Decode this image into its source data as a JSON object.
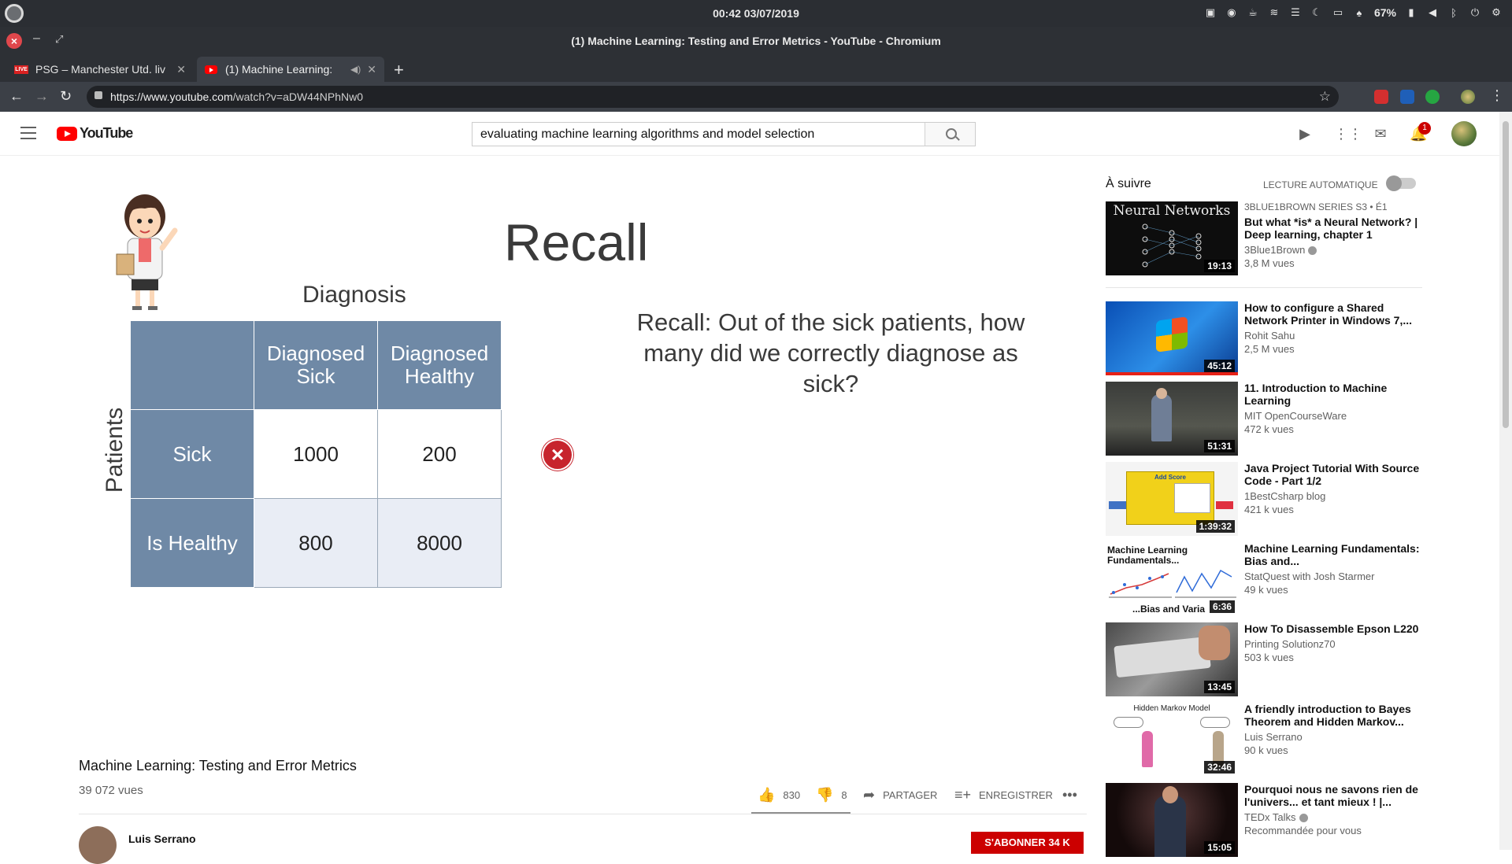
{
  "system": {
    "clock": "00:42 03/07/2019",
    "battery": "67%"
  },
  "window": {
    "title": "(1) Machine Learning: Testing and Error Metrics - YouTube - Chromium"
  },
  "tabs": [
    {
      "label": "PSG – Manchester Utd. liv",
      "badge": "LIVE"
    },
    {
      "label": "(1) Machine Learning:"
    }
  ],
  "address": {
    "host": "https://www.youtube.com",
    "path": "/watch?v=aDW44NPhNw0"
  },
  "youtube": {
    "wordmark": "YouTube",
    "search_query": "evaluating machine learning algorithms and model selection",
    "notification_count": "1"
  },
  "slide": {
    "title": "Recall",
    "diagnosis_label": "Diagnosis",
    "patients_label": "Patients",
    "col_headers": [
      "Diagnosed\nSick",
      "Diagnosed\nHealthy"
    ],
    "row_headers": [
      "Sick",
      "Is Healthy"
    ],
    "cells": [
      [
        "1000",
        "200"
      ],
      [
        "800",
        "8000"
      ]
    ],
    "recall_question": "Recall: Out of the sick patients, how many did we correctly diagnose as sick?"
  },
  "video": {
    "title": "Machine Learning: Testing and Error Metrics",
    "views": "39 072 vues",
    "likes": "830",
    "dislikes": "8",
    "share_label": "PARTAGER",
    "save_label": "ENREGISTRER",
    "channel": "Luis Serrano",
    "subscribe_label": "S'ABONNER  34 K"
  },
  "sidebar": {
    "up_next_label": "À suivre",
    "autoplay_label": "LECTURE AUTOMATIQUE",
    "items": [
      {
        "series": "3BLUE1BROWN SERIES  S3 • É1",
        "title": "But what *is* a Neural Network? | Deep learning, chapter 1",
        "channel": "3Blue1Brown",
        "views": "3,8 M vues",
        "duration": "19:13",
        "thumb_text": "Neural Networks"
      },
      {
        "title": "How to configure a Shared Network Printer in Windows 7,...",
        "channel": "Rohit Sahu",
        "views": "2,5 M vues",
        "duration": "45:12"
      },
      {
        "title": "11. Introduction to Machine Learning",
        "channel": "MIT OpenCourseWare",
        "views": "472 k vues",
        "duration": "51:31"
      },
      {
        "title": "Java Project Tutorial With Source Code - Part 1/2",
        "channel": "1BestCsharp blog",
        "views": "421 k vues",
        "duration": "1:39:32",
        "thumb_text": "Add Score"
      },
      {
        "title": "Machine Learning Fundamentals: Bias and...",
        "channel": "StatQuest with Josh Starmer",
        "views": "49 k vues",
        "duration": "6:36",
        "thumb_text": "Machine Learning Fundamentals...",
        "thumb_text2": "...Bias and Varia"
      },
      {
        "title": "How To Disassemble Epson L220",
        "channel": "Printing Solutionz70",
        "views": "503 k vues",
        "duration": "13:45"
      },
      {
        "title": "A friendly introduction to Bayes Theorem and Hidden Markov...",
        "channel": "Luis Serrano",
        "views": "90 k vues",
        "duration": "32:46",
        "thumb_text": "Hidden Markov Model"
      },
      {
        "title": "Pourquoi nous ne savons rien de l'univers... et tant mieux ! |...",
        "channel": "TEDx Talks",
        "views": "Recommandée pour vous",
        "duration": "15:05"
      }
    ]
  }
}
